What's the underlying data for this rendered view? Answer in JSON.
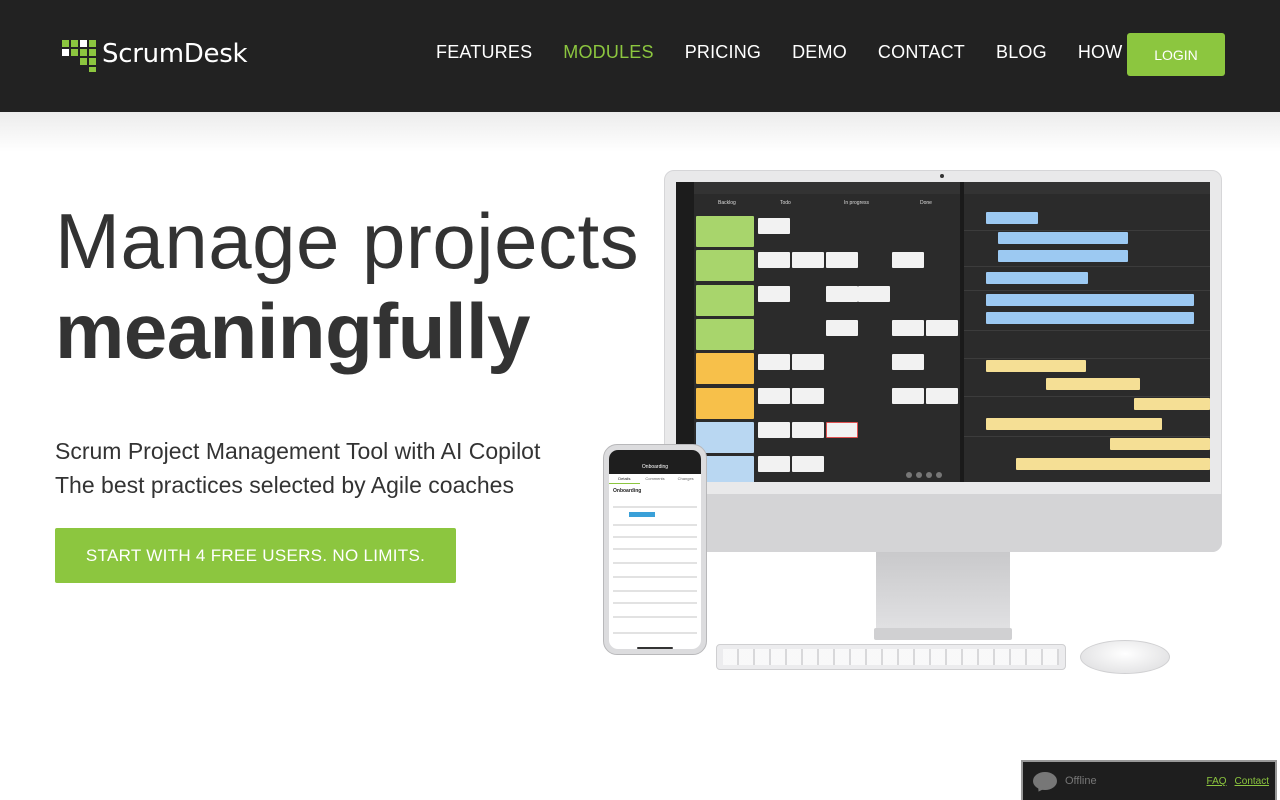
{
  "header": {
    "logo_text": "ScrumDesk",
    "nav": [
      {
        "label": "FEATURES",
        "active": false
      },
      {
        "label": "MODULES",
        "active": true
      },
      {
        "label": "PRICING",
        "active": false
      },
      {
        "label": "DEMO",
        "active": false
      },
      {
        "label": "CONTACT",
        "active": false
      },
      {
        "label": "BLOG",
        "active": false
      },
      {
        "label": "HOW TO",
        "active": false
      }
    ],
    "login_label": "LOGIN"
  },
  "hero": {
    "title_line1": "Manage projects",
    "title_line2": "meaningfully",
    "subtitle_line1": "Scrum Project Management Tool with AI Copilot",
    "subtitle_line2": "The best practices selected by Agile coaches",
    "cta_label": "START WITH 4 FREE USERS. NO LIMITS."
  },
  "screen": {
    "columns": [
      "Backlog",
      "Todo",
      "In progress",
      "Done"
    ]
  },
  "phone": {
    "title": "Onboarding",
    "tabs": [
      "Details",
      "Comments",
      "Changes"
    ],
    "heading": "Onboarding"
  },
  "chat": {
    "status": "Offline",
    "faq_label": "FAQ",
    "contact_label": "Contact"
  },
  "colors": {
    "brand_green": "#8cc63f",
    "header_bg": "#222222"
  }
}
